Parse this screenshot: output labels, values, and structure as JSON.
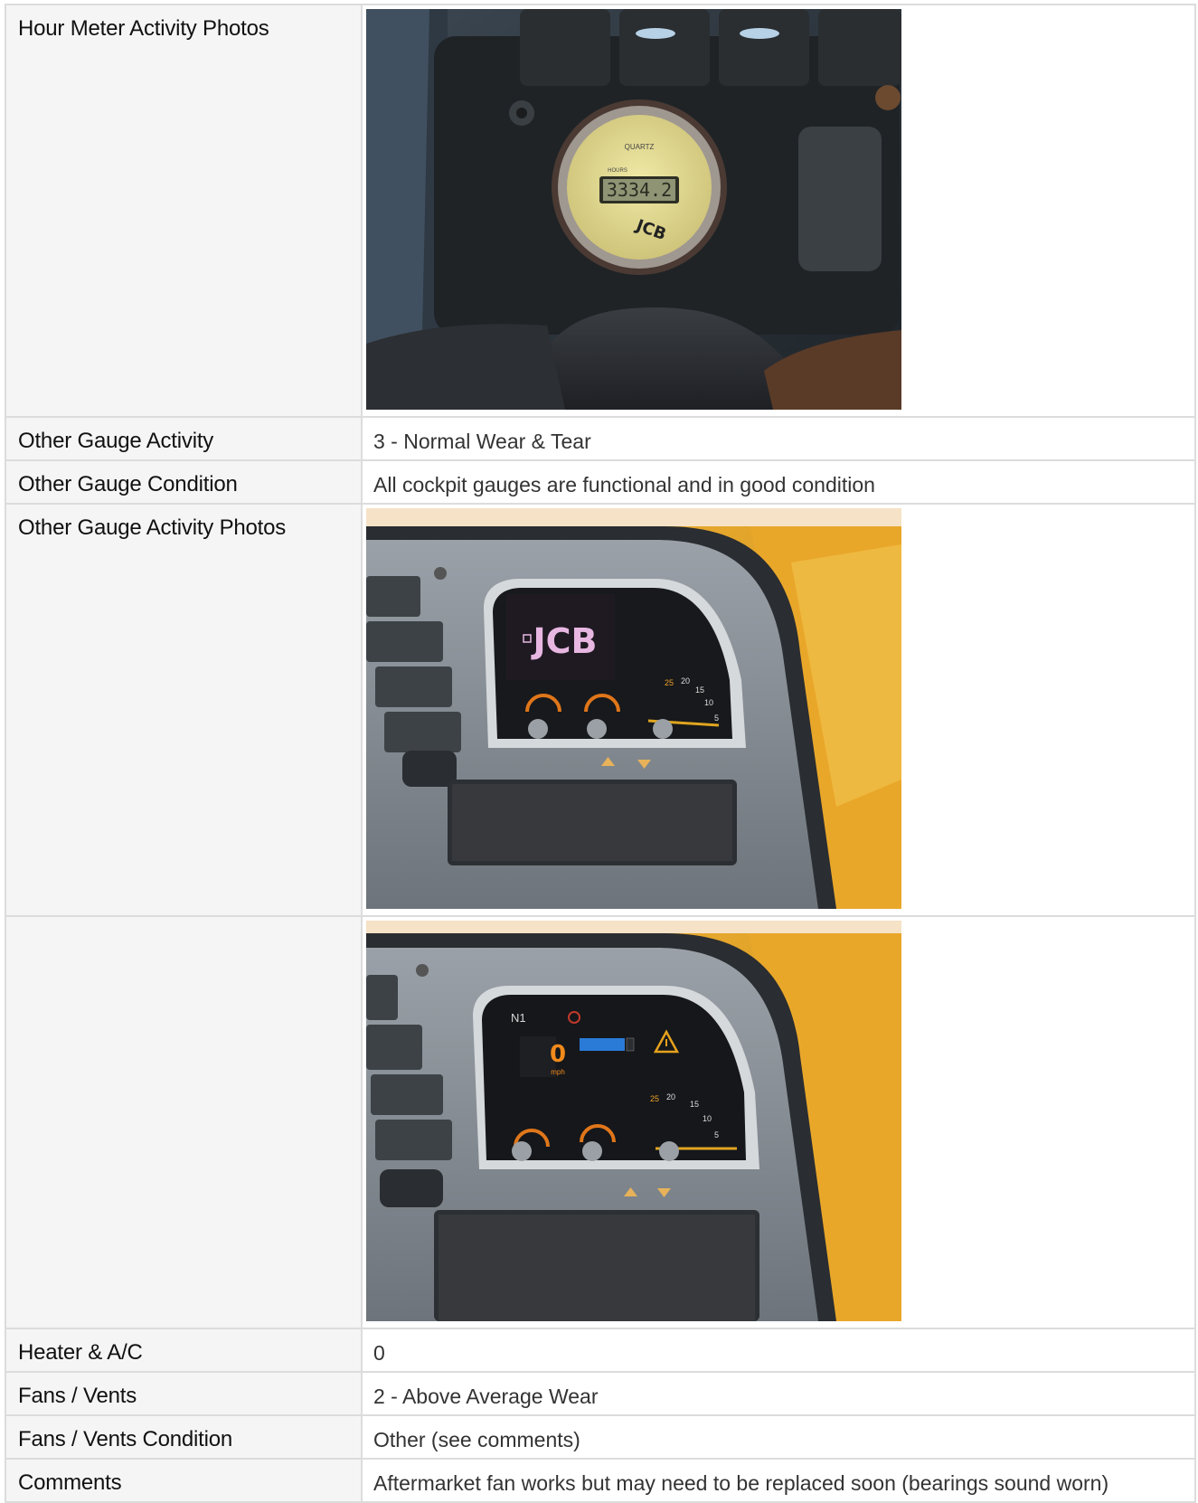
{
  "rows": [
    {
      "label": "Hour Meter Activity Photos",
      "kind": "photo",
      "photo": "hour-meter-photo",
      "gauge_display": "3334.2",
      "gauge_small_1": "QUARTZ",
      "gauge_small_2": "HOURS",
      "logo": "JCB"
    },
    {
      "label": "Other Gauge Activity",
      "kind": "text",
      "value": "3 - Normal Wear & Tear"
    },
    {
      "label": "Other Gauge Condition",
      "kind": "text",
      "value": "All cockpit gauges are functional and in good condition"
    },
    {
      "label": "Other Gauge Activity Photos",
      "kind": "photo",
      "photo": "instrument-cluster-photo-off",
      "logo": "JCB",
      "dial_nums": [
        "25",
        "20",
        "15",
        "10",
        "5"
      ]
    },
    {
      "label": "",
      "kind": "photo",
      "photo": "instrument-cluster-photo-on",
      "gear": "N1",
      "speed": "0",
      "speed_unit": "mph",
      "dial_nums": [
        "25",
        "20",
        "15",
        "10",
        "5"
      ]
    },
    {
      "label": "Heater & A/C",
      "kind": "text",
      "value": "0"
    },
    {
      "label": "Fans / Vents",
      "kind": "text",
      "value": "2 - Above Average Wear"
    },
    {
      "label": "Fans / Vents Condition",
      "kind": "text",
      "value": "Other (see comments)"
    },
    {
      "label": "Comments",
      "kind": "text",
      "value": "Aftermarket fan works but may need to be replaced soon (bearings sound worn)"
    }
  ],
  "colors": {
    "label_bg": "#f5f5f5",
    "border": "#dcdcdc",
    "label_text": "#111111",
    "value_text": "#333333"
  }
}
